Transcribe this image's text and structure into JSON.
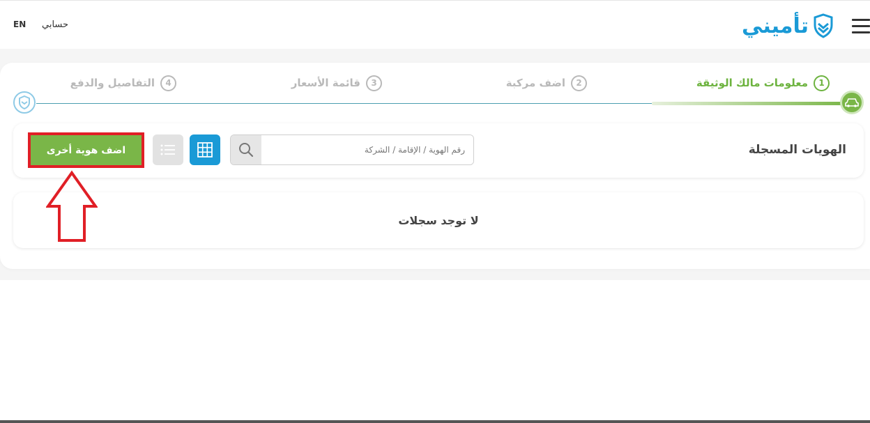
{
  "header": {
    "logo_text": "تأميني",
    "account_label": "حسابي",
    "lang_label": "EN"
  },
  "steps": [
    {
      "number": "1",
      "label": "معلومات مالك الوثيقة",
      "active": true
    },
    {
      "number": "2",
      "label": "اضف مركبة",
      "active": false
    },
    {
      "number": "3",
      "label": "قائمة الأسعار",
      "active": false
    },
    {
      "number": "4",
      "label": "التفاصيل والدفع",
      "active": false
    }
  ],
  "toolbar": {
    "title": "الهويات المسجلة",
    "search_placeholder": "رقم الهوية / الإقامة / الشركة",
    "add_button_label": "اضف هوية أخرى"
  },
  "empty_state": {
    "message": "لا توجد سجلات"
  },
  "colors": {
    "brand_blue": "#1a9ad6",
    "brand_green": "#7ab648",
    "highlight_red": "#e01f26",
    "inactive_grey": "#b9b9b9"
  },
  "icons": {
    "menu": "hamburger-icon",
    "logo": "shield-logo-icon",
    "search": "search-icon",
    "grid_view": "grid-icon",
    "list_view": "list-icon",
    "car": "car-icon",
    "final_step": "shield-icon",
    "annotation": "arrow-up-icon"
  }
}
